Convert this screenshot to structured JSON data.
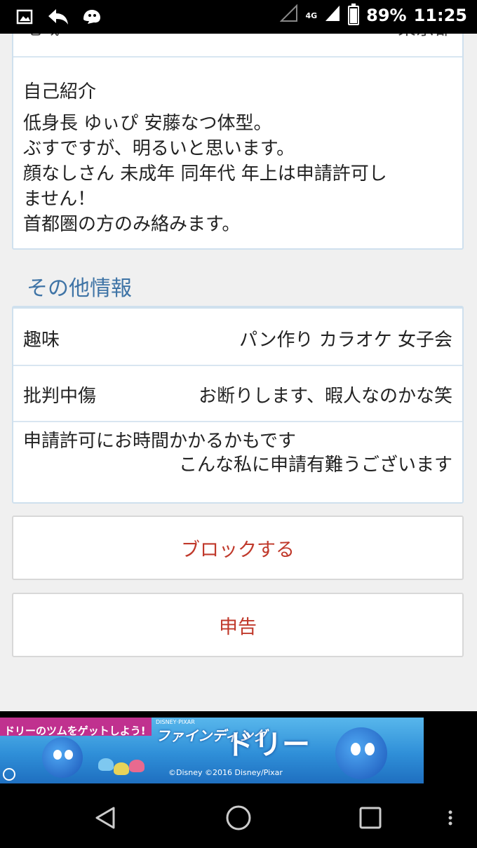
{
  "status_bar": {
    "network": "4G",
    "battery": "89%",
    "battery_level": 0.89,
    "time": "11:25"
  },
  "profile": {
    "region_label": "地域",
    "region_value": "東京都",
    "intro_heading": "自己紹介",
    "intro_text": "低身長 ゆぃぴ 安藤なつ体型。\nぶすですが、明るいと思います。\n顔なしさん 未成年 同年代 年上は申請許可し\nません！\n首都圏の方のみ絡みます。"
  },
  "other_info": {
    "title": "その他情報",
    "rows": [
      {
        "label": "趣味",
        "value": "パン作り カラオケ 女子会"
      },
      {
        "label": "批判中傷",
        "value": "お断りします、暇人なのかな笑"
      }
    ],
    "note_line1": "申請許可にお時間かかるかもです",
    "note_line2": "こんな私に申請有難うございます"
  },
  "actions": {
    "block_label": "ブロックする",
    "report_label": "申告"
  },
  "ad": {
    "tagline": "ドリーのツムをゲットしよう!",
    "brand": "DISNEY·PIXAR",
    "title": "ファインディング",
    "title_big": "ドリー",
    "copyright": "©Disney ©2016 Disney/Pixar"
  },
  "colors": {
    "accent": "#3f74a6",
    "danger": "#c0392b",
    "card_border": "#cfe0ee"
  }
}
